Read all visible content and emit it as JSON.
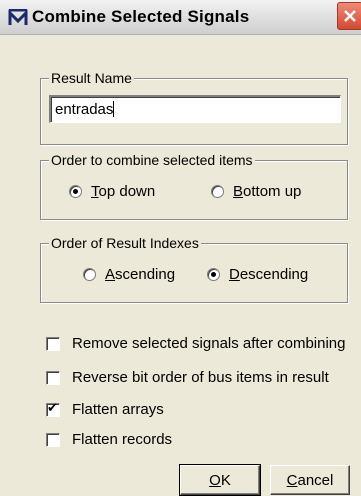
{
  "window": {
    "title": "Combine Selected Signals",
    "icon": "waveform-app-icon",
    "close_icon": "close-x-icon"
  },
  "result_name": {
    "label": "Result Name",
    "value": "entradas"
  },
  "combine_order": {
    "label": "Order to combine selected items",
    "options": [
      {
        "label": "Top down",
        "mnemonic": "T",
        "rest": "op down",
        "selected": true
      },
      {
        "label": "Bottom up",
        "mnemonic": "B",
        "rest": "ottom up",
        "selected": false
      }
    ]
  },
  "index_order": {
    "label": "Order of Result Indexes",
    "options": [
      {
        "label": "Ascending",
        "mnemonic": "A",
        "rest": "scending",
        "selected": false
      },
      {
        "label": "Descending",
        "mnemonic": "D",
        "rest": "escending",
        "selected": true
      }
    ]
  },
  "checkboxes": [
    {
      "label": "Remove selected signals after combining",
      "checked": false
    },
    {
      "label": "Reverse bit order of bus items in result",
      "checked": false
    },
    {
      "label": "Flatten arrays",
      "checked": true
    },
    {
      "label": "Flatten records",
      "checked": false
    }
  ],
  "buttons": {
    "ok": {
      "label": "OK",
      "mnemonic": "O",
      "rest": "K"
    },
    "cancel": {
      "label": "Cancel",
      "mnemonic": "C",
      "rest": "ancel"
    }
  }
}
